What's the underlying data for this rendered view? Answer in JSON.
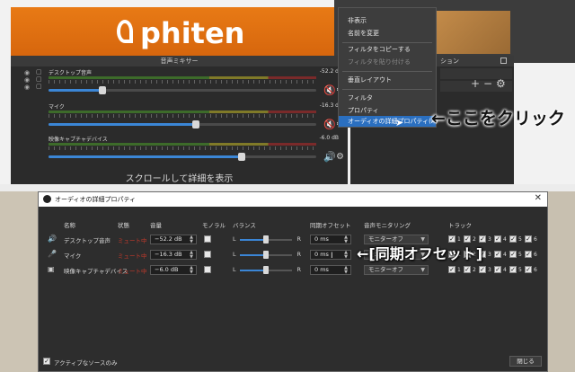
{
  "camera": {
    "logo_text": "phiten"
  },
  "mixer": {
    "title": "音声ミキサー",
    "tracks": [
      {
        "name": "デスクトップ音声",
        "db": "-52.2 d",
        "volume_fraction": 0.2,
        "muted": true
      },
      {
        "name": "マイク",
        "db": "-16.3 d",
        "volume_fraction": 0.55,
        "muted": true
      },
      {
        "name": "映像キャプチャデバイス",
        "db": "-6.0 dB",
        "volume_fraction": 0.72,
        "muted": false
      }
    ],
    "scroll_hint": "スクロールして詳細を表示"
  },
  "sources_panel": {
    "title": "ション",
    "add": "+",
    "remove": "−",
    "settings": "⚙"
  },
  "context_menu": {
    "items": [
      {
        "label": "非表示",
        "enabled": true
      },
      {
        "label": "名前を変更",
        "enabled": true
      },
      {
        "label": "フィルタをコピーする",
        "enabled": true
      },
      {
        "label": "フィルタを貼り付ける",
        "enabled": false
      },
      {
        "label": "垂直レイアウト",
        "enabled": true
      },
      {
        "label": "フィルタ",
        "enabled": true
      },
      {
        "label": "プロパティ",
        "enabled": true
      },
      {
        "label": "オーディオの詳細プロパティ(A)",
        "enabled": true,
        "selected": true
      }
    ]
  },
  "annotations": {
    "click_here": "←ここをクリック",
    "sync_offset": "←[同期オフセット]"
  },
  "dialog": {
    "title": "オーディオの詳細プロパティ",
    "close_x": "✕",
    "headers": {
      "name": "名称",
      "status": "状態",
      "volume": "音量",
      "mono": "モノラル",
      "balance": "バランス",
      "sync_offset": "同期オフセット",
      "monitoring": "音声モニタリング",
      "tracks": "トラック"
    },
    "balance_left": "L",
    "balance_right": "R",
    "rows": [
      {
        "icon": "🔊",
        "name": "デスクトップ音声",
        "status": "ミュート中",
        "volume": "−52.2 dB",
        "mono": false,
        "balance": 0.5,
        "offset": "0 ms",
        "monitoring": "モニターオフ",
        "tracks": [
          true,
          true,
          true,
          true,
          true,
          true
        ]
      },
      {
        "icon": "🎤",
        "name": "マイク",
        "status": "ミュート中",
        "volume": "−16.3 dB",
        "mono": false,
        "balance": 0.5,
        "offset": "0 ms",
        "monitoring": "モニターオフ",
        "tracks": [
          true,
          true,
          true,
          true,
          true,
          true
        ]
      },
      {
        "icon": "▣",
        "name": "映像キャプチャデバイス",
        "status": "ミュート中",
        "volume": "−6.0 dB",
        "mono": false,
        "balance": 0.5,
        "offset": "0 ms",
        "monitoring": "モニターオフ",
        "tracks": [
          true,
          true,
          true,
          true,
          true,
          true
        ]
      }
    ],
    "track_numbers": [
      "1",
      "2",
      "3",
      "4",
      "5",
      "6"
    ],
    "active_only_label": "アクティブなソースのみ",
    "active_only_checked": true,
    "close_button": "閉じる"
  }
}
